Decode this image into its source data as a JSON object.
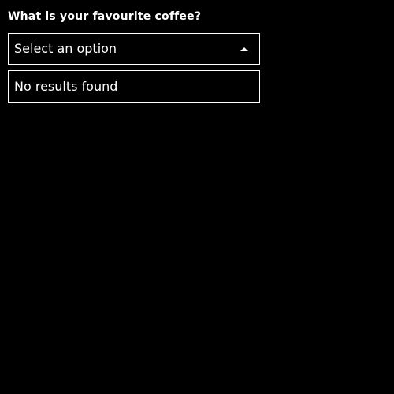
{
  "form": {
    "label": "What is your favourite coffee?",
    "select": {
      "placeholder": "Select an option",
      "caret_icon": "caret-up-icon"
    },
    "dropdown": {
      "empty_message": "No results found"
    }
  },
  "colors": {
    "background": "#000000",
    "foreground": "#ffffff",
    "border": "#ffffff"
  }
}
